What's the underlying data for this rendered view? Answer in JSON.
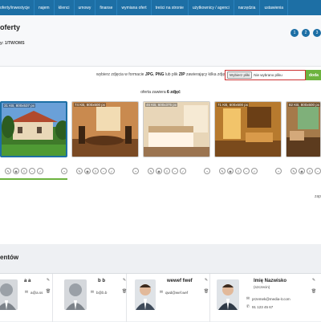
{
  "nav": {
    "items": [
      "oferty/inwestycje",
      "najem",
      "klienci",
      "umowy",
      "finanse",
      "wymiana ofert",
      "treści na stronie",
      "użytkownicy / agenci",
      "narzędzia",
      "ustawienia"
    ]
  },
  "header": {
    "title": "oferty",
    "subtitle": "y: 1/TW/OMS",
    "steps": [
      "1",
      "2",
      "3"
    ]
  },
  "upload": {
    "hint_prefix": "wybierz zdjęcia w formacie",
    "fmt1": "JPG",
    "fmt2": "PNG",
    "mid": "lub plik",
    "fmt3": "ZIP",
    "hint_suffix": "zawierający kilka zdjęć",
    "file_button": "Wybierz pliki",
    "file_status": "Nie wybrano pliku",
    "add_label": "doda"
  },
  "gallery": {
    "count_prefix": "oferta zawiera",
    "count_value": "6 zdjęć",
    "photos": [
      {
        "label": "31 KB, 800x537 px"
      },
      {
        "label": "74 KB, 800x600 px"
      },
      {
        "label": "46 KB, 600x375 px"
      },
      {
        "label": "71 KB, 600x600 px"
      },
      {
        "label": "82 KB, 800x600 px"
      }
    ],
    "tool_icons": [
      "pencil-icon",
      "eye-icon",
      "list-icon",
      "minus-icon",
      "check-icon",
      "plus-icon"
    ],
    "nav_hint": "zap"
  },
  "agents": {
    "title": "entów",
    "list": [
      {
        "name": "a a",
        "email": "a@a.ss",
        "place": "",
        "phone": ""
      },
      {
        "name": "b b",
        "email": "b@b.b",
        "place": "",
        "phone": ""
      },
      {
        "name": "wewef fwef",
        "email": "qwd@wef.wef",
        "place": "",
        "phone": ""
      },
      {
        "name": "Imię Nazwisko",
        "email": "przemek@media-it.com",
        "place": "(szczecin)",
        "phone": "91 123 45 67"
      }
    ]
  },
  "colors": {
    "nav": "#1d6fa5",
    "accent_green": "#6db33f",
    "error_border": "#c33"
  }
}
